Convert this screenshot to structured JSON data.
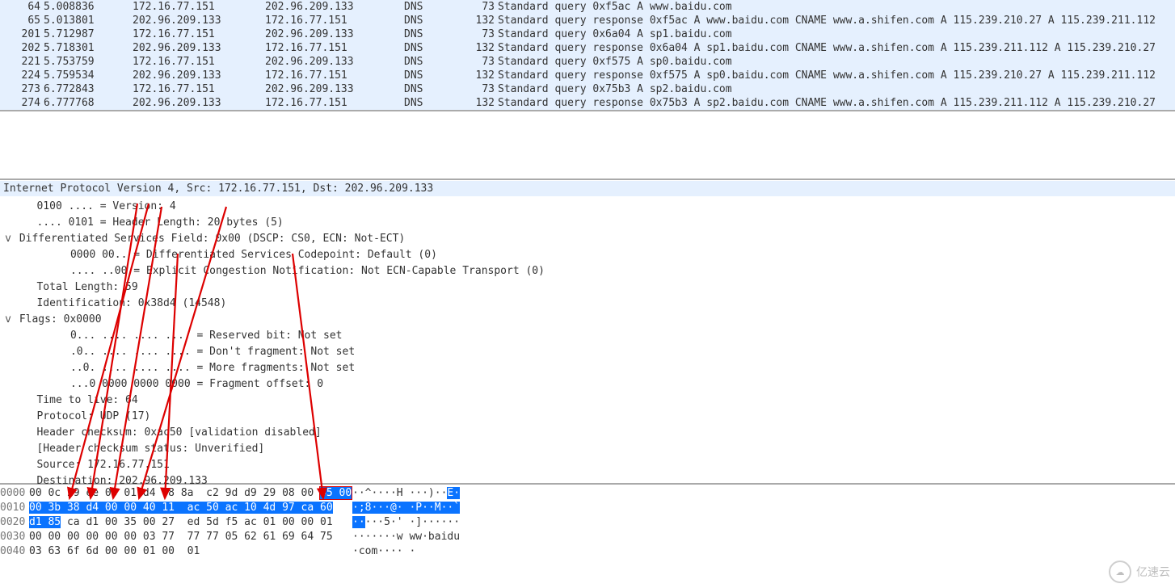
{
  "packets": [
    {
      "no": "64",
      "time": "5.008836",
      "src": "172.16.77.151",
      "dst": "202.96.209.133",
      "proto": "DNS",
      "len": "73",
      "info": "Standard query 0xf5ac A www.baidu.com"
    },
    {
      "no": "65",
      "time": "5.013801",
      "src": "202.96.209.133",
      "dst": "172.16.77.151",
      "proto": "DNS",
      "len": "132",
      "info": "Standard query response 0xf5ac A www.baidu.com CNAME www.a.shifen.com A 115.239.210.27 A 115.239.211.112"
    },
    {
      "no": "201",
      "time": "5.712987",
      "src": "172.16.77.151",
      "dst": "202.96.209.133",
      "proto": "DNS",
      "len": "73",
      "info": "Standard query 0x6a04 A sp1.baidu.com"
    },
    {
      "no": "202",
      "time": "5.718301",
      "src": "202.96.209.133",
      "dst": "172.16.77.151",
      "proto": "DNS",
      "len": "132",
      "info": "Standard query response 0x6a04 A sp1.baidu.com CNAME www.a.shifen.com A 115.239.211.112 A 115.239.210.27"
    },
    {
      "no": "221",
      "time": "5.753759",
      "src": "172.16.77.151",
      "dst": "202.96.209.133",
      "proto": "DNS",
      "len": "73",
      "info": "Standard query 0xf575 A sp0.baidu.com"
    },
    {
      "no": "224",
      "time": "5.759534",
      "src": "202.96.209.133",
      "dst": "172.16.77.151",
      "proto": "DNS",
      "len": "132",
      "info": "Standard query response 0xf575 A sp0.baidu.com CNAME www.a.shifen.com A 115.239.210.27 A 115.239.211.112"
    },
    {
      "no": "273",
      "time": "6.772843",
      "src": "172.16.77.151",
      "dst": "202.96.209.133",
      "proto": "DNS",
      "len": "73",
      "info": "Standard query 0x75b3 A sp2.baidu.com"
    },
    {
      "no": "274",
      "time": "6.777768",
      "src": "202.96.209.133",
      "dst": "172.16.77.151",
      "proto": "DNS",
      "len": "132",
      "info": "Standard query response 0x75b3 A sp2.baidu.com CNAME www.a.shifen.com A 115.239.211.112 A 115.239.210.27"
    }
  ],
  "section_header": "Internet Protocol Version 4, Src: 172.16.77.151, Dst: 202.96.209.133",
  "tree_lines": [
    {
      "indent": 1,
      "expander": "",
      "text": "0100 .... = Version: 4"
    },
    {
      "indent": 1,
      "expander": "",
      "text": ".... 0101 = Header Length: 20 bytes (5)"
    },
    {
      "indent": 0,
      "expander": "v",
      "text": "Differentiated Services Field: 0x00 (DSCP: CS0, ECN: Not-ECT)"
    },
    {
      "indent": 2,
      "expander": "",
      "text": "0000 00.. = Differentiated Services Codepoint: Default (0)"
    },
    {
      "indent": 2,
      "expander": "",
      "text": ".... ..00 = Explicit Congestion Notification: Not ECN-Capable Transport (0)"
    },
    {
      "indent": 1,
      "expander": "",
      "text": "Total Length: 59"
    },
    {
      "indent": 1,
      "expander": "",
      "text": "Identification: 0x38d4 (14548)"
    },
    {
      "indent": 0,
      "expander": "v",
      "text": "Flags: 0x0000"
    },
    {
      "indent": 2,
      "expander": "",
      "text": "0... .... .... .... = Reserved bit: Not set"
    },
    {
      "indent": 2,
      "expander": "",
      "text": ".0.. .... .... .... = Don't fragment: Not set"
    },
    {
      "indent": 2,
      "expander": "",
      "text": "..0. .... .... .... = More fragments: Not set"
    },
    {
      "indent": 2,
      "expander": "",
      "text": "...0 0000 0000 0000 = Fragment offset: 0"
    },
    {
      "indent": 1,
      "expander": "",
      "text": "Time to live: 64"
    },
    {
      "indent": 1,
      "expander": "",
      "text": "Protocol: UDP (17)"
    },
    {
      "indent": 1,
      "expander": "",
      "text": "Header checksum: 0xac50 [validation disabled]"
    },
    {
      "indent": 1,
      "expander": "",
      "text": "[Header checksum status: Unverified]"
    },
    {
      "indent": 1,
      "expander": "",
      "text": "Source: 172.16.77.151"
    },
    {
      "indent": 1,
      "expander": "",
      "text": "Destination: 202.96.209.133"
    }
  ],
  "hex": {
    "rows": [
      {
        "off": "0000",
        "bytes": "00 0c 29 ee 00 01 d4 78 8a  c2 9d d9 29 08 00 ",
        "bytes_hl": "45 00",
        "ascii": "··^····H ···)··",
        "ascii_hl": "E·"
      },
      {
        "off": "0010",
        "bytes_hl_full": "00 3b 38 d4 00 00 40 11  ac 50 ac 10 4d 97 ca 60",
        "ascii_hl_full": "·;8···@· ·P··M··`"
      },
      {
        "off": "0020",
        "bytes_hl": "d1 85",
        "bytes": " ca d1 00 35 00 27  ed 5d f5 ac 01 00 00 01",
        "ascii_hl": "··",
        "ascii": "···5·' ·]······"
      },
      {
        "off": "0030",
        "bytes": "00 00 00 00 00 00 03 77  77 77 05 62 61 69 64 75",
        "ascii": "·······w ww·baidu"
      },
      {
        "off": "0040",
        "bytes": "03 63 6f 6d 00 00 01 00  01",
        "ascii": "·com···· ·"
      }
    ]
  },
  "watermark": "亿速云"
}
